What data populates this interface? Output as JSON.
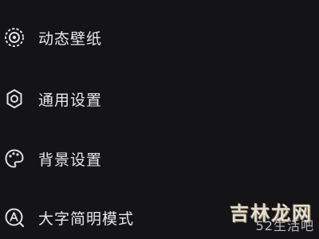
{
  "menu": {
    "items": [
      {
        "label": "动态壁纸",
        "icon": "live-wallpaper-icon"
      },
      {
        "label": "通用设置",
        "icon": "gear-icon"
      },
      {
        "label": "背景设置",
        "icon": "palette-icon"
      },
      {
        "label": "大字简明模式",
        "icon": "large-font-icon"
      }
    ]
  },
  "watermark": {
    "line1": "吉林龙网",
    "line2": "52生活吧"
  },
  "colors": {
    "background": "#141417",
    "text": "#e9e9eb",
    "icon": "#e0e0e2"
  }
}
